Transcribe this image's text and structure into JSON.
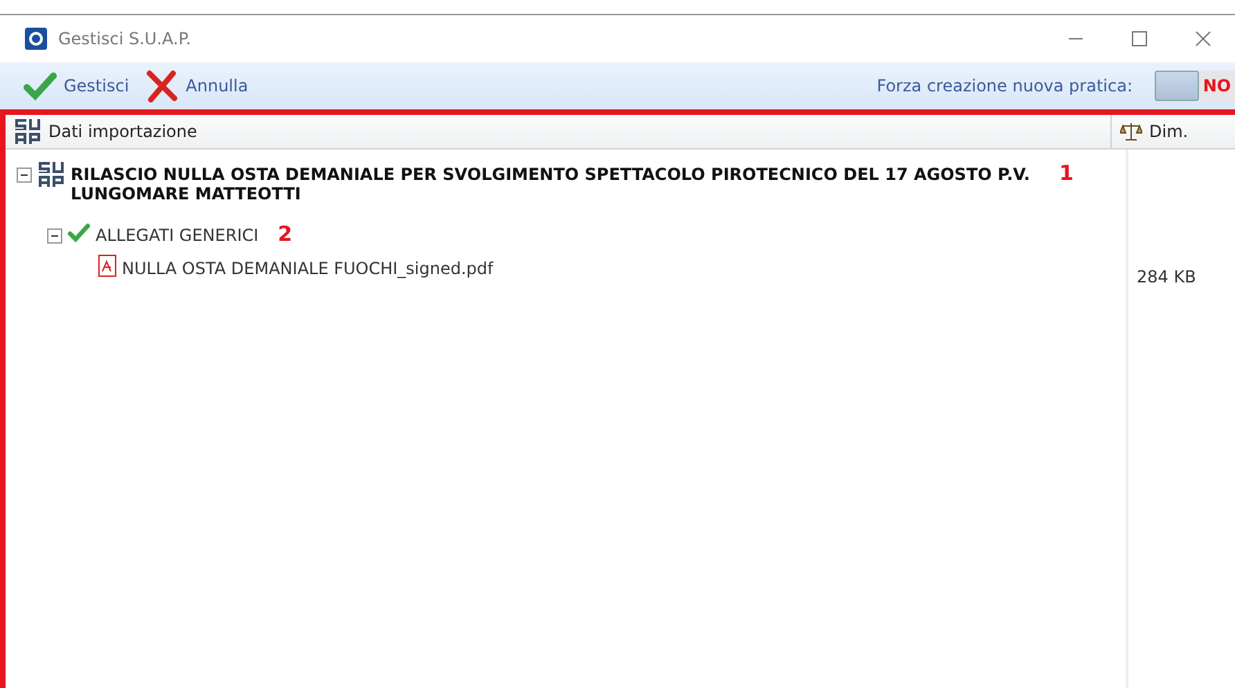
{
  "window": {
    "title": "Gestisci S.U.A.P."
  },
  "toolbar": {
    "buttons": [
      {
        "kind": "confirm",
        "label": "Gestisci"
      },
      {
        "kind": "cancel",
        "label": "Annulla"
      }
    ],
    "toggle": {
      "label": "Forza creazione nuova pratica:",
      "value": "NO",
      "on": false
    }
  },
  "table": {
    "columns": [
      {
        "kind": "name",
        "label": "Dati importazione"
      },
      {
        "kind": "size",
        "label": "Dim."
      }
    ],
    "tree": [
      {
        "kind": "practice",
        "label": "RILASCIO NULLA OSTA DEMANIALE PER SVOLGIMENTO SPETTACOLO PIROTECNICO DEL 17 AGOSTO P.V. LUNGOMARE MATTEOTTI",
        "expanded": true,
        "annotation": "1",
        "children": [
          {
            "kind": "folder",
            "label": "ALLEGATI GENERICI",
            "expanded": true,
            "annotation": "2",
            "children": [
              {
                "kind": "pdf",
                "label": "NULLA OSTA DEMANIALE FUOCHI_signed.pdf",
                "size": "284 KB"
              }
            ]
          }
        ]
      }
    ]
  }
}
